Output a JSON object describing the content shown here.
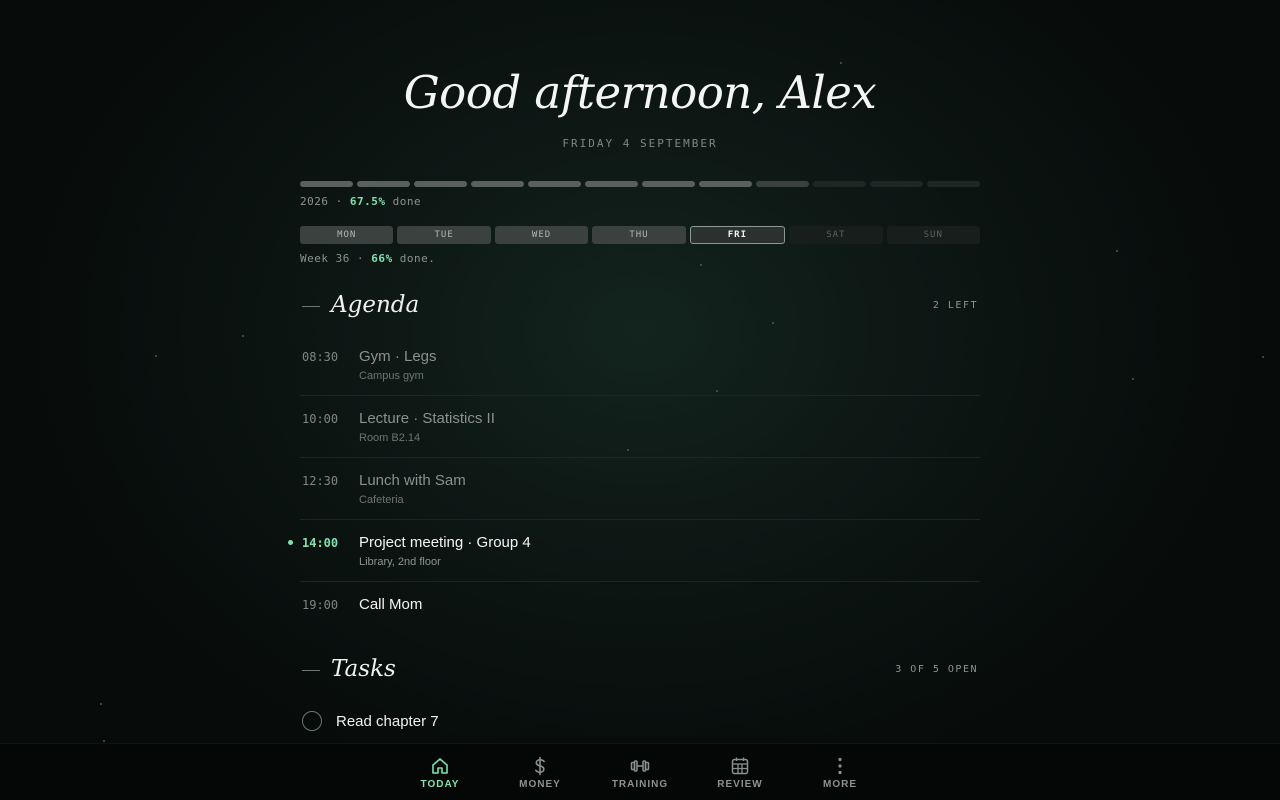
{
  "greeting": "Good afternoon, Alex",
  "date": "FRIDAY 4 SEPTEMBER",
  "year_progress": {
    "year": "2026",
    "percent_text": "67.5%",
    "suffix": "done",
    "segments_done": 8,
    "segments_total": 12
  },
  "week": {
    "days": [
      {
        "label": "MON",
        "state": "past"
      },
      {
        "label": "TUE",
        "state": "past"
      },
      {
        "label": "WED",
        "state": "past"
      },
      {
        "label": "THU",
        "state": "past"
      },
      {
        "label": "FRI",
        "state": "today"
      },
      {
        "label": "SAT",
        "state": "future"
      },
      {
        "label": "SUN",
        "state": "future"
      }
    ],
    "label": "Week 36",
    "percent_text": "66%",
    "suffix": "done."
  },
  "agenda": {
    "title": "Agenda",
    "meta": "2 LEFT",
    "events": [
      {
        "time": "08:30",
        "name": "Gym · Legs",
        "place": "Campus gym",
        "state": "past"
      },
      {
        "time": "10:00",
        "name": "Lecture · Statistics II",
        "place": "Room B2.14",
        "state": "past"
      },
      {
        "time": "12:30",
        "name": "Lunch with Sam",
        "place": "Cafeteria",
        "state": "past"
      },
      {
        "time": "14:00",
        "name": "Project meeting · Group 4",
        "place": "Library, 2nd floor",
        "state": "current"
      },
      {
        "time": "19:00",
        "name": "Call Mom",
        "place": "",
        "state": "upcoming"
      }
    ]
  },
  "tasks": {
    "title": "Tasks",
    "meta": "3 OF 5 OPEN",
    "items": [
      {
        "label": "Read chapter 7",
        "done": false
      }
    ]
  },
  "nav": {
    "items": [
      {
        "label": "TODAY",
        "icon": "home-icon",
        "active": true
      },
      {
        "label": "MONEY",
        "icon": "dollar-icon",
        "active": false
      },
      {
        "label": "TRAINING",
        "icon": "dumbbell-icon",
        "active": false
      },
      {
        "label": "REVIEW",
        "icon": "calendar-icon",
        "active": false
      },
      {
        "label": "MORE",
        "icon": "more-vertical-icon",
        "active": false
      }
    ]
  },
  "colors": {
    "accent": "#7fe0b0",
    "background": "#0b1210",
    "text": "#eef1ef",
    "muted": "#8a938e"
  }
}
